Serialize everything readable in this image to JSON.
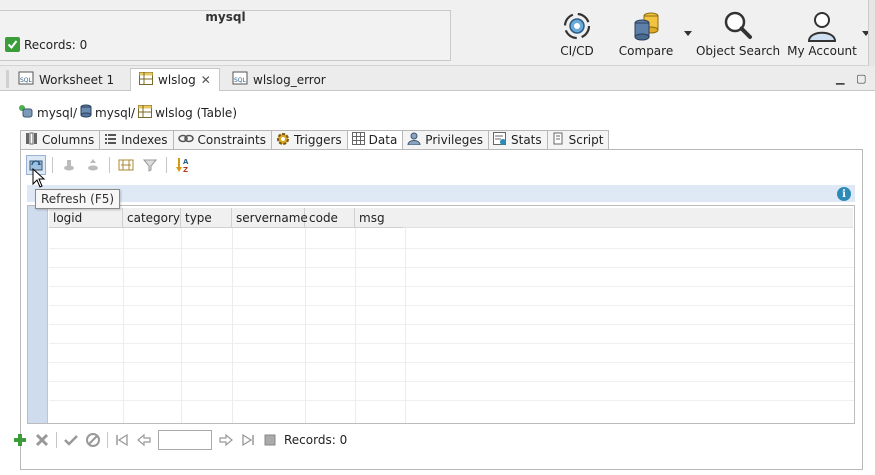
{
  "connection": {
    "title": "mysql",
    "records_status": "Records: 0"
  },
  "toolbar": {
    "cicd_label": "CI/CD",
    "compare_label": "Compare",
    "object_search_label": "Object Search",
    "account_label": "My Account"
  },
  "editor_tabs": [
    {
      "label": "Worksheet 1"
    },
    {
      "label": "wlslog"
    },
    {
      "label": "wlslog_error"
    }
  ],
  "breadcrumb": {
    "part1": "mysql/",
    "part2": "mysql/",
    "part3": "wlslog (Table)"
  },
  "object_tabs": [
    "Columns",
    "Indexes",
    "Constraints",
    "Triggers",
    "Data",
    "Privileges",
    "Stats",
    "Script"
  ],
  "tooltip": {
    "text": "Refresh (F5)"
  },
  "grid": {
    "columns": [
      "logid",
      "category",
      "type",
      "servername",
      "code",
      "msg"
    ]
  },
  "nav": {
    "records": "Records: 0",
    "page_value": ""
  },
  "colors": {
    "accent": "#2c8ab7",
    "status_green": "#3a9d3a",
    "gutter": "#cfdcee"
  }
}
